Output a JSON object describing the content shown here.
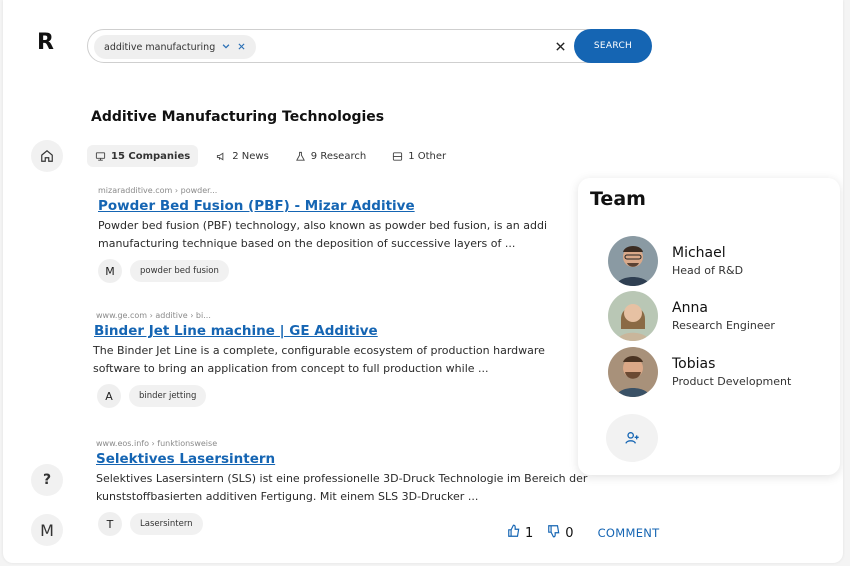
{
  "app": {
    "logo": "R"
  },
  "search": {
    "chip_label": "additive manufacturing",
    "button_label": "SEARCH"
  },
  "page": {
    "title": "Additive Manufacturing Technologies"
  },
  "tabs": [
    {
      "label": "15 Companies",
      "icon": "building-icon",
      "active": true
    },
    {
      "label": "2 News",
      "icon": "megaphone-icon",
      "active": false
    },
    {
      "label": "9 Research",
      "icon": "flask-icon",
      "active": false
    },
    {
      "label": "1 Other",
      "icon": "box-icon",
      "active": false
    }
  ],
  "results": [
    {
      "url": "mizaradditive.com › powder...",
      "title": "Powder Bed Fusion (PBF) - Mizar Additive",
      "desc_line1": "Powder bed fusion (PBF) technology, also known as powder bed fusion, is an addi",
      "desc_line2": "manufacturing technique based on the deposition of successive layers of ...",
      "initial": "M",
      "tag": "powder bed fusion"
    },
    {
      "url": "www.ge.com › additive › bi...",
      "title": "Binder Jet Line machine | GE Additive",
      "desc_line1": "The Binder Jet Line is a complete, configurable ecosystem of production hardware",
      "desc_line2": "software to bring an application from concept to full production while ...",
      "initial": "A",
      "tag": "binder jetting"
    },
    {
      "url": "www.eos.info › funktionsweise",
      "title": "Selektives Lasersintern",
      "desc_line1": "Selektives Lasersintern (SLS) ist eine professionelle 3D-Druck Technologie im Bereich der",
      "desc_line2": "kunststoffbasierten additiven Fertigung. Mit einem SLS 3D-Drucker ...",
      "initial": "T",
      "tag": "Lasersintern"
    }
  ],
  "team": {
    "title": "Team",
    "members": [
      {
        "name": "Michael",
        "role": "Head of R&D"
      },
      {
        "name": "Anna",
        "role": "Research Engineer"
      },
      {
        "name": "Tobias",
        "role": "Product Development"
      }
    ]
  },
  "actions": {
    "likes": "1",
    "dislikes": "0",
    "comment_label": "COMMENT"
  },
  "sidebar": {
    "help": "?",
    "user_initial": "M"
  },
  "colors": {
    "accent": "#1565b3"
  }
}
